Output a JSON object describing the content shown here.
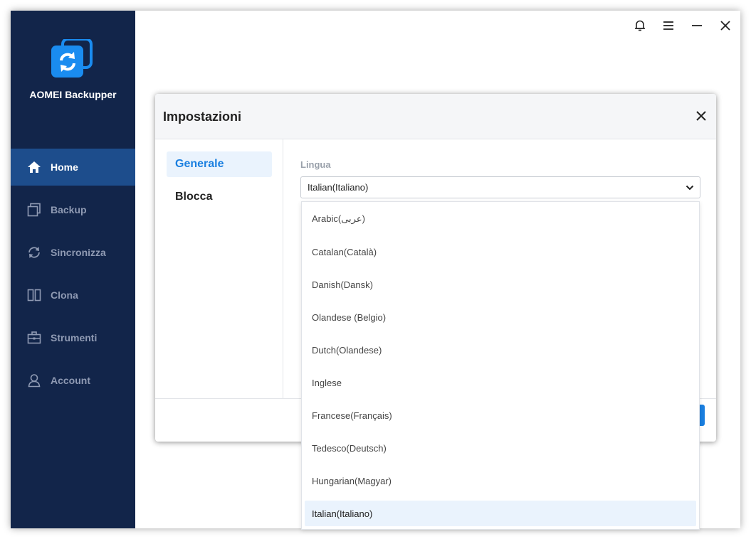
{
  "app": {
    "name": "AOMEI Backupper",
    "brand_color": "#1a7fe0",
    "sidebar_color": "#12254a"
  },
  "sidebar": {
    "items": [
      {
        "label": "Home",
        "icon": "home-icon",
        "active": true
      },
      {
        "label": "Backup",
        "icon": "backup-icon",
        "active": false
      },
      {
        "label": "Sincronizza",
        "icon": "sync-icon",
        "active": false
      },
      {
        "label": "Clona",
        "icon": "clone-icon",
        "active": false
      },
      {
        "label": "Strumenti",
        "icon": "toolbox-icon",
        "active": false
      },
      {
        "label": "Account",
        "icon": "user-icon",
        "active": false
      }
    ]
  },
  "topbar": {
    "icons": [
      "bell-icon",
      "menu-icon",
      "minimize-icon",
      "close-icon"
    ]
  },
  "dialog": {
    "title": "Impostazioni",
    "nav": [
      {
        "label": "Generale",
        "active": true
      },
      {
        "label": "Blocca",
        "active": false
      }
    ],
    "language_label": "Lingua",
    "language_selected": "Italian(Italiano)"
  },
  "dropdown": {
    "options": [
      "Arabic(عربى)",
      "Catalan(Català)",
      "Danish(Dansk)",
      "Olandese (Belgio)",
      "Dutch(Olandese)",
      "Inglese",
      "Francese(Français)",
      "Tedesco(Deutsch)",
      "Hungarian(Magyar)",
      "Italian(Italiano)"
    ],
    "selected_index": 9
  }
}
